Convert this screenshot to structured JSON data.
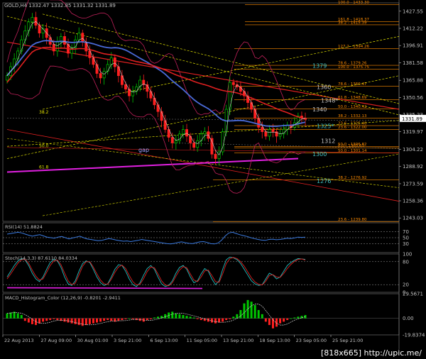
{
  "header": {
    "symbol_line": "GOLD,H4  1332.47 1332.85 1331.32 1331.89"
  },
  "watermark": "[818x665] http://upic.me/",
  "colors": {
    "up": "#00c800",
    "down": "#ff2020",
    "axis": "#c0c0c0",
    "fib": "#ff8c00",
    "bb": "#c0205a",
    "ma_slow": "#4a6ad8",
    "ma_red": "#e02020",
    "magenta": "#e020e0",
    "cyan": "#40c0c0",
    "yellow": "#e0e000"
  },
  "chart_data": [
    {
      "type": "candlestick",
      "title": "GOLD,H4",
      "ylim": [
        1240,
        1435
      ],
      "y_ticks": [
        "1427.55",
        "1412.22",
        "1396.91",
        "1381.58",
        "1365.88",
        "1350.56",
        "1335.23",
        "1319.97",
        "1304.22",
        "1288.92",
        "1273.59",
        "1258.36",
        "1243.03"
      ],
      "current_price": "1331.89",
      "x_ticks": [
        "22 Aug 2013",
        "27 Aug 09:00",
        "30 Aug 01:00",
        "3 Sep 21:00",
        "6 Sep 13:00",
        "11 Sep 05:00",
        "13 Sep 21:00",
        "18 Sep 13:00",
        "23 Sep 05:00",
        "25 Sep 21:00"
      ],
      "close": [
        1370,
        1378,
        1385,
        1392,
        1402,
        1410,
        1418,
        1422,
        1415,
        1408,
        1412,
        1404,
        1398,
        1392,
        1400,
        1405,
        1398,
        1390,
        1395,
        1402,
        1408,
        1400,
        1392,
        1386,
        1380,
        1372,
        1368,
        1374,
        1380,
        1386,
        1378,
        1370,
        1362,
        1358,
        1352,
        1356,
        1360,
        1366,
        1362,
        1356,
        1350,
        1344,
        1338,
        1330,
        1322,
        1315,
        1310,
        1312,
        1318,
        1322,
        1316,
        1310,
        1306,
        1312,
        1318,
        1320,
        1314,
        1300,
        1296,
        1302,
        1320,
        1340,
        1364,
        1362,
        1360,
        1356,
        1352,
        1346,
        1340,
        1332,
        1324,
        1320,
        1316,
        1322,
        1320,
        1316,
        1318,
        1322,
        1326,
        1324,
        1328,
        1334,
        1332,
        1331
      ],
      "fib_levels": [
        {
          "label": "100.0 - 1433.30",
          "value": 1433.3
        },
        {
          "label": "161.8 - 1418.37",
          "value": 1418.37
        },
        {
          "label": "38.2 - 1415.39",
          "value": 1415.39
        },
        {
          "label": "127.2 - 1394.26",
          "value": 1394.26
        },
        {
          "label": "78.6 - 1379.26",
          "value": 1379.26
        },
        {
          "label": "100.0 - 1375.75",
          "value": 1375.75
        },
        {
          "label": "78.6 - 1360.47",
          "value": 1360.47
        },
        {
          "label": "61.8 - 1348.69",
          "value": 1348.69
        },
        {
          "label": "50.0 - 1340.42",
          "value": 1340.42
        },
        {
          "label": "38.2 - 1332.13",
          "value": 1332.13
        },
        {
          "label": "23.6 - 1325.40",
          "value": 1325.4
        },
        {
          "label": "23.6 - 1322.00",
          "value": 1322.0
        },
        {
          "label": "0.0 - 1305.63",
          "value": 1305.63
        },
        {
          "label": "50.0 - 1306.82",
          "value": 1306.82
        },
        {
          "label": "50.0 - 1301.14",
          "value": 1301.14
        },
        {
          "label": "38.2 - 1276.92",
          "value": 1276.92
        },
        {
          "label": "23.6 - 1239.80",
          "value": 1239.8
        }
      ],
      "level_labels": [
        {
          "text": "1379",
          "value": 1379,
          "color": "#40c0c0"
        },
        {
          "text": "1360",
          "value": 1360,
          "color": "#c0c0c0"
        },
        {
          "text": "1348*",
          "value": 1348,
          "color": "#c0c0c0"
        },
        {
          "text": "1340",
          "value": 1340,
          "color": "#c0c0c0"
        },
        {
          "text": "1325*",
          "value": 1325,
          "color": "#40c0c0"
        },
        {
          "text": "1312",
          "value": 1312,
          "color": "#c0c0c0"
        },
        {
          "text": "1300",
          "value": 1300,
          "color": "#40c0c0"
        },
        {
          "text": "1276",
          "value": 1276,
          "color": "#40c0c0"
        }
      ],
      "annotations": [
        {
          "text": "gap",
          "value": 1304
        },
        {
          "text": "38.2",
          "value": 1338
        },
        {
          "text": "50.0",
          "value": 1308
        },
        {
          "text": "61.8",
          "value": 1289
        }
      ]
    },
    {
      "type": "line",
      "title": "RSI(14) 51.8824",
      "ylim": [
        0,
        100
      ],
      "y_ticks": [
        "70",
        "50",
        "30"
      ],
      "values": [
        62,
        64,
        66,
        68,
        66,
        62,
        58,
        55,
        58,
        60,
        56,
        52,
        50,
        48,
        52,
        54,
        50,
        46,
        49,
        52,
        55,
        50,
        46,
        44,
        42,
        40,
        41,
        44,
        47,
        45,
        42,
        40,
        38,
        39,
        37,
        39,
        41,
        44,
        42,
        40,
        38,
        36,
        34,
        32,
        30,
        29,
        31,
        34,
        36,
        33,
        31,
        30,
        33,
        36,
        37,
        34,
        30,
        29,
        32,
        42,
        56,
        66,
        68,
        64,
        60,
        57,
        54,
        50,
        47,
        44,
        42,
        41,
        44,
        45,
        43,
        44,
        46,
        48,
        47,
        49,
        52,
        51,
        52
      ]
    },
    {
      "type": "line",
      "title": "Stoch(14,3,3) 87.6110 84.0334",
      "ylim": [
        0,
        100
      ],
      "y_ticks": [
        "100",
        "80",
        "20",
        "0"
      ],
      "series": [
        {
          "values": [
            40,
            55,
            70,
            82,
            88,
            85,
            70,
            50,
            35,
            28,
            40,
            60,
            78,
            86,
            82,
            65,
            40,
            22,
            18,
            30,
            55,
            75,
            82,
            78,
            60,
            40,
            25,
            18,
            22,
            40,
            60,
            72,
            70,
            55,
            35,
            20,
            15,
            25,
            45,
            62,
            70,
            60,
            40,
            22,
            15,
            18,
            30,
            50,
            65,
            70,
            60,
            40,
            25,
            30,
            48,
            62,
            55,
            35,
            20,
            30,
            60,
            85,
            92,
            90,
            85,
            75,
            60,
            45,
            30,
            22,
            18,
            20,
            35,
            50,
            45,
            35,
            40,
            55,
            70,
            78,
            84,
            88,
            87,
            86
          ]
        },
        {
          "values": [
            35,
            48,
            62,
            76,
            85,
            86,
            76,
            58,
            42,
            32,
            35,
            52,
            70,
            82,
            84,
            72,
            50,
            30,
            20,
            24,
            45,
            68,
            80,
            80,
            66,
            48,
            32,
            22,
            21,
            34,
            52,
            66,
            71,
            62,
            44,
            28,
            19,
            21,
            36,
            54,
            66,
            64,
            48,
            30,
            19,
            17,
            25,
            42,
            58,
            67,
            64,
            48,
            32,
            28,
            40,
            56,
            58,
            44,
            28,
            26,
            48,
            75,
            88,
            91,
            88,
            80,
            68,
            53,
            38,
            27,
            21,
            19,
            29,
            44,
            46,
            40,
            39,
            49,
            62,
            73,
            81,
            86,
            87,
            84
          ]
        }
      ]
    },
    {
      "type": "bar",
      "title": "MACD_Histogram_Color (12,26,9)  -0.8201 -2.9411",
      "ylim": [
        -19.8374,
        29.5671
      ],
      "y_ticks": [
        "29.5671",
        "0.00",
        "-19.8374"
      ],
      "values": [
        6,
        7,
        8,
        6,
        4,
        -3,
        -5,
        -7,
        -8,
        -6,
        -4,
        -3,
        -2,
        -1,
        -2,
        -3,
        -4,
        -5,
        -6,
        -7,
        -8,
        -9,
        -8,
        -7,
        -6,
        -5,
        -4,
        -3,
        -2,
        -3,
        -4,
        -3,
        -2,
        -1,
        0,
        -1,
        -2,
        -3,
        -4,
        -2,
        -1,
        1,
        2,
        3,
        5,
        7,
        8,
        6,
        5,
        4,
        3,
        2,
        1,
        -1,
        -2,
        -3,
        -4,
        -5,
        -6,
        -5,
        -4,
        -2,
        -1,
        2,
        5,
        10,
        18,
        22,
        20,
        16,
        10,
        5,
        -4,
        -8,
        -12,
        -10,
        -6,
        -4,
        -2,
        0,
        1,
        2,
        3,
        4
      ]
    }
  ]
}
